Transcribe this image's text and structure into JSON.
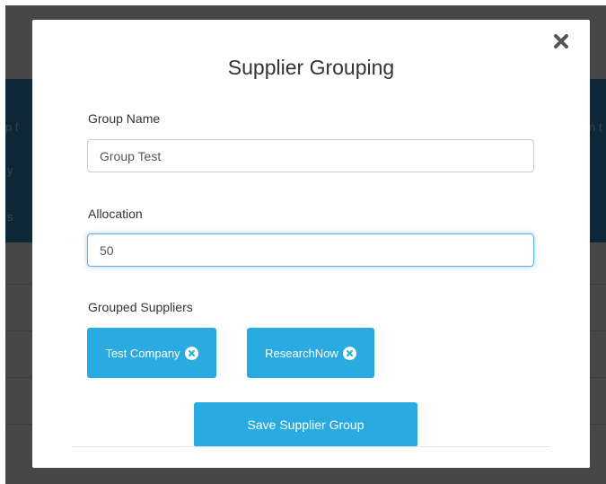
{
  "background": {
    "left_fragments": [
      "p f",
      "y",
      "s"
    ],
    "right_fragments": [
      "n t"
    ]
  },
  "modal": {
    "title": "Supplier Grouping",
    "close_icon": "close-icon",
    "group_name": {
      "label": "Group Name",
      "value": "Group Test"
    },
    "allocation": {
      "label": "Allocation",
      "value": "50"
    },
    "grouped_suppliers": {
      "label": "Grouped Suppliers",
      "chips": [
        {
          "label": "Test Company",
          "icon": "remove-circle-icon"
        },
        {
          "label": "ResearchNow",
          "icon": "remove-circle-icon"
        }
      ]
    },
    "save_button_label": "Save Supplier Group"
  },
  "colors": {
    "accent": "#29abe2",
    "overlay": "#000000",
    "background_header": "#2f8ecb",
    "focus_border": "#66afe9"
  }
}
